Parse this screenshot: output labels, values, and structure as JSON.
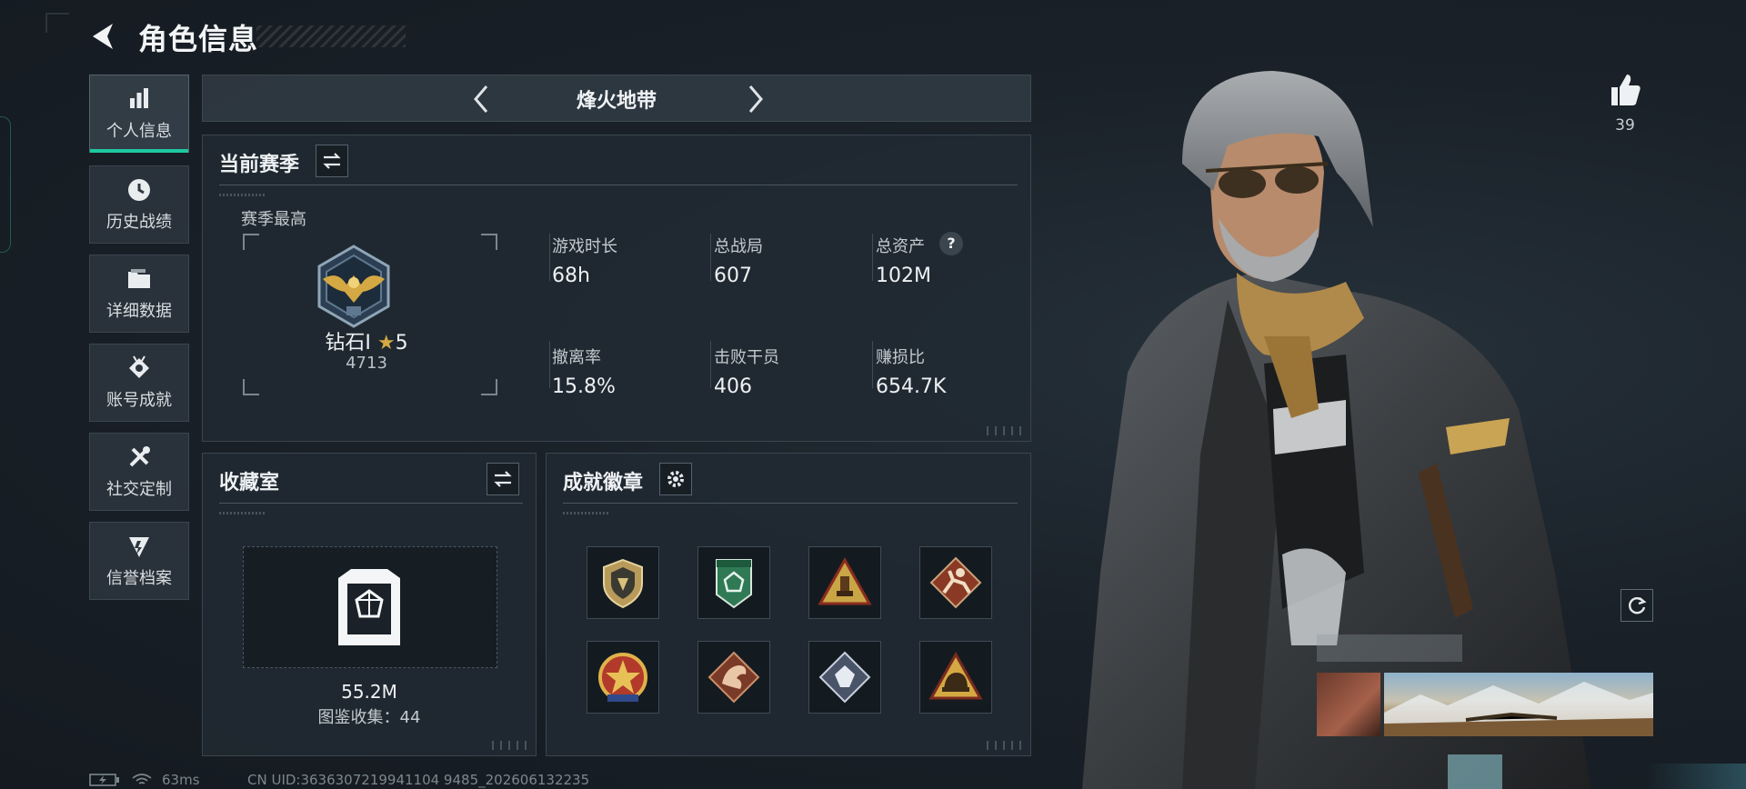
{
  "header": {
    "title": "角色信息"
  },
  "nav": {
    "items": [
      {
        "label": "个人信息",
        "icon": "bar-chart-icon",
        "active": true
      },
      {
        "label": "历史战绩",
        "icon": "clock-icon",
        "active": false
      },
      {
        "label": "详细数据",
        "icon": "folder-icon",
        "active": false
      },
      {
        "label": "账号成就",
        "icon": "achievement-icon",
        "active": false
      },
      {
        "label": "社交定制",
        "icon": "tools-icon",
        "active": false
      },
      {
        "label": "信誉档案",
        "icon": "shield-icon",
        "active": false
      }
    ]
  },
  "mode": {
    "name": "烽火地带"
  },
  "season": {
    "title": "当前赛季",
    "best_label": "赛季最高",
    "rank_name": "钻石I",
    "rank_stars": "5",
    "rank_score": "4713",
    "stats": [
      {
        "label": "游戏时长",
        "value": "68h"
      },
      {
        "label": "总战局",
        "value": "607"
      },
      {
        "label": "总资产",
        "value": "102M",
        "help": "?"
      },
      {
        "label": "撤离率",
        "value": "15.8%"
      },
      {
        "label": "击败干员",
        "value": "406"
      },
      {
        "label": "赚损比",
        "value": "654.7K"
      }
    ]
  },
  "collection": {
    "title": "收藏室",
    "value": "55.2M",
    "catalog_label": "图鉴收集：44"
  },
  "achievements": {
    "title": "成就徽章",
    "badges": [
      "shield-badge",
      "green-leaf-badge",
      "gold-triangle-badge",
      "runner-badge",
      "star-medal-badge",
      "dragon-badge",
      "diamond-badge",
      "helmet-badge"
    ]
  },
  "profile": {
    "likes": "39"
  },
  "status": {
    "ping": "63ms",
    "uid": "CN UID:3636307219941104 9485_202606132235"
  },
  "colors": {
    "accent": "#1ec8a0",
    "gold": "#d4a843"
  }
}
